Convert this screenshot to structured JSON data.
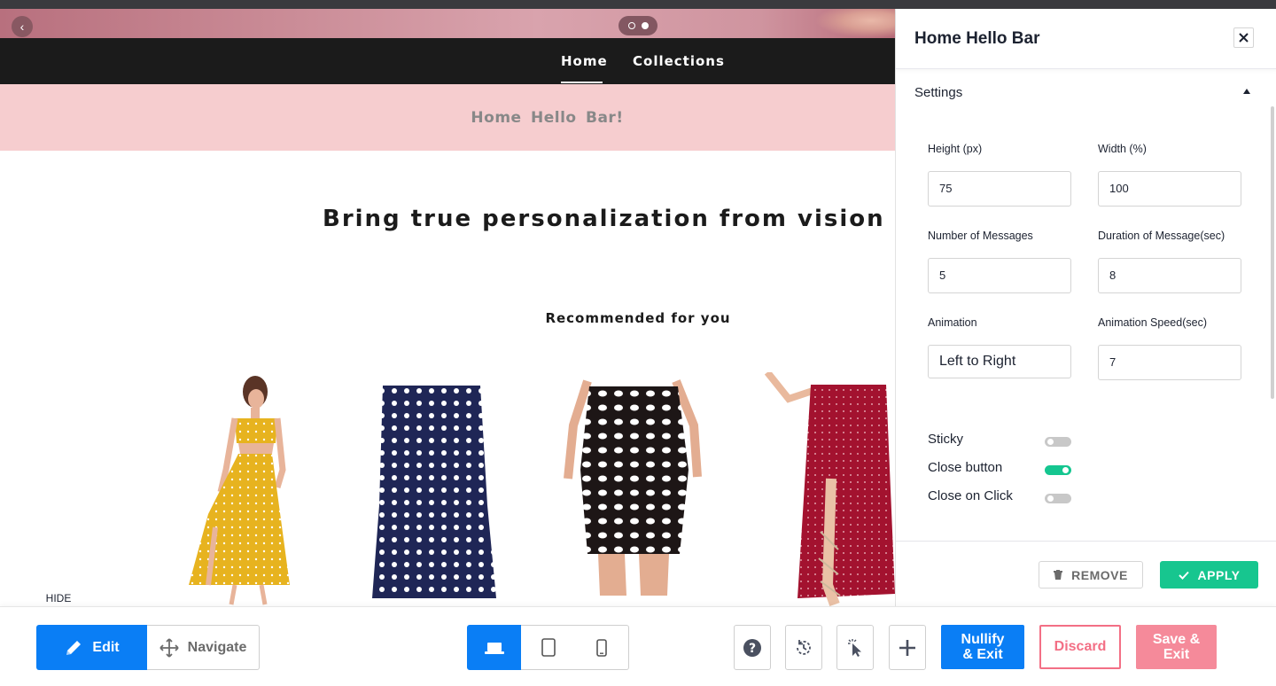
{
  "store": {
    "nav": {
      "home": "Home",
      "collections": "Collections"
    },
    "hello_bar_text": "Home  Hello  Bar!",
    "headline": "Bring true personalization from vision to reality",
    "recommended_heading": "Recommended for you",
    "products": [
      {
        "icon": "yellow-polka-dot-dress-image"
      },
      {
        "icon": "navy-polka-dot-skirt-image"
      },
      {
        "icon": "black-polka-dot-pencil-skirt-image"
      },
      {
        "icon": "red-polka-dot-wrap-skirt-image"
      }
    ]
  },
  "panel": {
    "title": "Home Hello Bar",
    "section": "Settings",
    "fields": {
      "height_label": "Height (px)",
      "height_value": "75",
      "width_label": "Width (%)",
      "width_value": "100",
      "messages_label": "Number of Messages",
      "messages_value": "5",
      "duration_label": "Duration of Message(sec)",
      "duration_value": "8",
      "animation_label": "Animation",
      "animation_value": "Left to Right",
      "speed_label": "Animation Speed(sec)",
      "speed_value": "7"
    },
    "toggles": [
      {
        "label": "Sticky",
        "on": false
      },
      {
        "label": "Close button",
        "on": true
      },
      {
        "label": "Close on Click",
        "on": false
      }
    ],
    "remove_label": "REMOVE",
    "apply_label": "APPLY"
  },
  "toolbar": {
    "hide_label": "HIDE",
    "edit_label": "Edit",
    "navigate_label": "Navigate",
    "nullify_line1": "Nullify",
    "nullify_line2": "& Exit",
    "discard_label": "Discard",
    "save_line1": "Save &",
    "save_line2": "Exit"
  },
  "colors": {
    "primary": "#0a7ef5",
    "success": "#17c68f",
    "danger": "#f36f85",
    "hello_bar_bg": "#f6cdcf",
    "store_nav_bg": "#1b1b1b"
  }
}
